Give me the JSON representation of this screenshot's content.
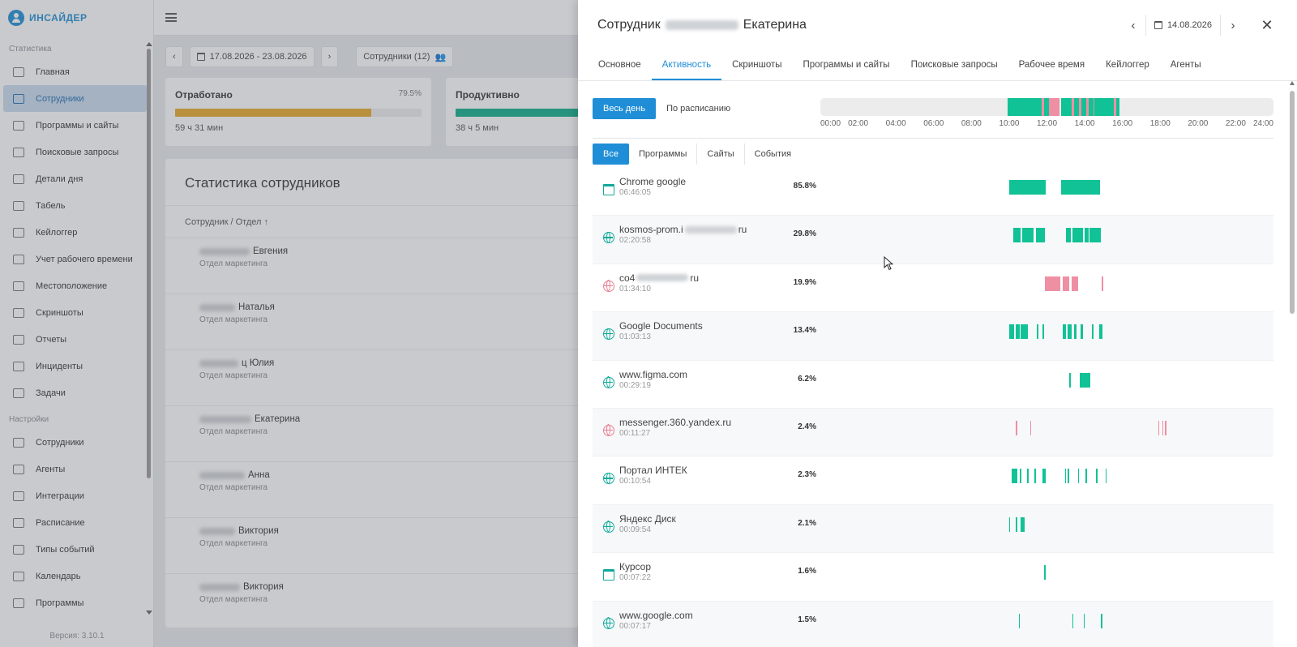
{
  "brand": {
    "logo_text": "ИНСАЙДЕР"
  },
  "sidebar": {
    "section_stats": "Статистика",
    "section_settings": "Настройки",
    "stats_items": [
      {
        "label": "Главная",
        "icon": "dashboard-icon",
        "active": false
      },
      {
        "label": "Сотрудники",
        "icon": "users-icon",
        "active": true
      },
      {
        "label": "Программы и сайты",
        "icon": "window-icon",
        "active": false
      },
      {
        "label": "Поисковые запросы",
        "icon": "search-icon",
        "active": false
      },
      {
        "label": "Детали дня",
        "icon": "chart-line-icon",
        "active": false
      },
      {
        "label": "Табель",
        "icon": "document-icon",
        "active": false
      },
      {
        "label": "Кейлоггер",
        "icon": "keyboard-icon",
        "active": false
      },
      {
        "label": "Учет рабочего времени",
        "icon": "clock-calendar-icon",
        "active": false
      },
      {
        "label": "Местоположение",
        "icon": "location-pin-icon",
        "active": false
      },
      {
        "label": "Скриншоты",
        "icon": "screenshot-icon",
        "active": false
      },
      {
        "label": "Отчеты",
        "icon": "report-icon",
        "active": false
      },
      {
        "label": "Инциденты",
        "icon": "alert-icon",
        "active": false
      },
      {
        "label": "Задачи",
        "icon": "check-circle-icon",
        "active": false
      }
    ],
    "settings_items": [
      {
        "label": "Сотрудники",
        "icon": "user-settings-icon"
      },
      {
        "label": "Агенты",
        "icon": "monitor-icon"
      },
      {
        "label": "Интеграции",
        "icon": "integration-icon"
      },
      {
        "label": "Расписание",
        "icon": "schedule-icon"
      },
      {
        "label": "Типы событий",
        "icon": "calendar-check-icon"
      },
      {
        "label": "Календарь",
        "icon": "calendar-icon"
      },
      {
        "label": "Программы",
        "icon": "apps-icon"
      }
    ],
    "version": "Версия: 3.10.1"
  },
  "main": {
    "date_range": "17.08.2026 - 23.08.2026",
    "employees_filter": "Сотрудники (12)",
    "cards": [
      {
        "title": "Отработано",
        "percent": "79.5%",
        "value": "59 ч 31 мин",
        "fill_percent": 79.5,
        "color": "#e6a92b"
      },
      {
        "title": "Продуктивно",
        "percent": "",
        "value": "38 ч 5 мин",
        "fill_percent": 100,
        "color": "#0fae8a"
      }
    ],
    "stats_title": "Статистика сотрудников",
    "column_header": "Сотрудник / Отдел ↑",
    "employees": [
      {
        "name": "Евгения",
        "dept": "Отдел маркетинга"
      },
      {
        "name": "Наталья",
        "dept": "Отдел маркетинга"
      },
      {
        "name": "ц Юлия",
        "dept": "Отдел маркетинга"
      },
      {
        "name": "Екатерина",
        "dept": "Отдел маркетинга"
      },
      {
        "name": "Анна",
        "dept": "Отдел маркетинга"
      },
      {
        "name": "Виктория",
        "dept": "Отдел маркетинга"
      },
      {
        "name": "Виктория",
        "dept": "Отдел маркетинга"
      }
    ]
  },
  "drawer": {
    "title_prefix": "Сотрудник",
    "title_name": "Екатерина",
    "date": "14.08.2026",
    "tabs": [
      {
        "label": "Основное",
        "active": false
      },
      {
        "label": "Активность",
        "active": true
      },
      {
        "label": "Скриншоты",
        "active": false
      },
      {
        "label": "Программы и сайты",
        "active": false
      },
      {
        "label": "Поисковые запросы",
        "active": false
      },
      {
        "label": "Рабочее время",
        "active": false
      },
      {
        "label": "Кейлоггер",
        "active": false
      },
      {
        "label": "Агенты",
        "active": false
      }
    ],
    "range_modes": {
      "all_day": "Весь день",
      "by_schedule": "По расписанию"
    },
    "timeline_labels": [
      "00:00",
      "02:00",
      "04:00",
      "06:00",
      "08:00",
      "10:00",
      "12:00",
      "14:00",
      "16:00",
      "18:00",
      "20:00",
      "22:00",
      "24:00"
    ],
    "filters": [
      "Все",
      "Программы",
      "Сайты",
      "События"
    ],
    "colors": {
      "productive": "#10c296",
      "unproductive": "#ef8fa3",
      "accent": "#1f8ed6"
    },
    "activities": [
      {
        "name": "Chrome google",
        "time": "06:46:05",
        "percent": "85.8%",
        "icon": "window-icon",
        "color": "green",
        "segments": [
          [
            10.0,
            11.95
          ],
          [
            12.75,
            14.8
          ]
        ]
      },
      {
        "name": "kosmos-prom.i",
        "name_suffix": "ru",
        "redacted": true,
        "time": "02:20:58",
        "percent": "29.8%",
        "icon": "globe-icon",
        "color": "green",
        "segments": [
          [
            10.2,
            10.6
          ],
          [
            10.7,
            11.3
          ],
          [
            11.4,
            11.9
          ],
          [
            13.0,
            13.25
          ],
          [
            13.35,
            13.9
          ],
          [
            14.0,
            14.2
          ],
          [
            14.25,
            14.85
          ]
        ]
      },
      {
        "name": "co4",
        "name_suffix": "ru",
        "redacted": true,
        "time": "01:34:10",
        "percent": "19.9%",
        "icon": "globe-icon",
        "color": "red",
        "segments": [
          [
            11.9,
            12.7
          ],
          [
            12.85,
            13.2
          ],
          [
            13.3,
            13.65
          ],
          [
            14.9,
            14.95
          ]
        ]
      },
      {
        "name": "Google Documents",
        "time": "01:03:13",
        "percent": "13.4%",
        "icon": "globe-icon",
        "color": "green",
        "segments": [
          [
            10.0,
            10.25
          ],
          [
            10.35,
            10.55
          ],
          [
            10.6,
            11.0
          ],
          [
            11.45,
            11.55
          ],
          [
            11.75,
            11.85
          ],
          [
            12.85,
            13.0
          ],
          [
            13.1,
            13.3
          ],
          [
            13.45,
            13.55
          ],
          [
            13.8,
            13.9
          ],
          [
            14.4,
            14.45
          ],
          [
            14.75,
            14.95
          ]
        ]
      },
      {
        "name": "www.figma.com",
        "time": "00:29:19",
        "percent": "6.2%",
        "icon": "globe-icon",
        "color": "green",
        "segments": [
          [
            13.2,
            13.25
          ],
          [
            13.75,
            14.3
          ]
        ]
      },
      {
        "name": "messenger.360.yandex.ru",
        "time": "00:11:27",
        "percent": "2.4%",
        "icon": "globe-icon",
        "color": "red",
        "segments": [
          [
            10.35,
            10.4
          ],
          [
            11.1,
            11.15
          ],
          [
            17.9,
            17.95
          ],
          [
            18.1,
            18.15
          ],
          [
            18.25,
            18.3
          ]
        ]
      },
      {
        "name": "Портал ИНТЕК",
        "time": "00:10:54",
        "percent": "2.3%",
        "icon": "globe-icon",
        "color": "green",
        "segments": [
          [
            10.15,
            10.45
          ],
          [
            10.55,
            10.65
          ],
          [
            10.95,
            11.0
          ],
          [
            11.35,
            11.4
          ],
          [
            11.75,
            11.95
          ],
          [
            12.95,
            13.0
          ],
          [
            13.1,
            13.2
          ],
          [
            13.65,
            13.7
          ],
          [
            14.05,
            14.1
          ],
          [
            14.6,
            14.65
          ],
          [
            15.1,
            15.15
          ]
        ]
      },
      {
        "name": "Яндекс Диск",
        "time": "00:09:54",
        "percent": "2.1%",
        "icon": "globe-icon",
        "color": "green",
        "segments": [
          [
            10.0,
            10.05
          ],
          [
            10.35,
            10.4
          ],
          [
            10.6,
            10.8
          ]
        ]
      },
      {
        "name": "Курсор",
        "time": "00:07:22",
        "percent": "1.6%",
        "icon": "window-icon",
        "color": "green",
        "segments": [
          [
            11.85,
            11.95
          ]
        ]
      },
      {
        "name": "www.google.com",
        "time": "00:07:17",
        "percent": "1.5%",
        "icon": "globe-icon",
        "color": "green",
        "segments": [
          [
            10.5,
            10.55
          ],
          [
            13.35,
            13.4
          ],
          [
            13.95,
            14.0
          ],
          [
            14.85,
            14.95
          ]
        ]
      }
    ],
    "overview_segments": [
      {
        "from": 9.9,
        "to": 11.6,
        "color": "green"
      },
      {
        "from": 11.6,
        "to": 12.1,
        "color": "mixed"
      },
      {
        "from": 12.1,
        "to": 12.65,
        "color": "red"
      },
      {
        "from": 12.75,
        "to": 13.2,
        "color": "green"
      },
      {
        "from": 13.2,
        "to": 14.5,
        "color": "mixed"
      },
      {
        "from": 14.5,
        "to": 15.4,
        "color": "green"
      },
      {
        "from": 15.4,
        "to": 15.8,
        "color": "mixed"
      }
    ]
  }
}
